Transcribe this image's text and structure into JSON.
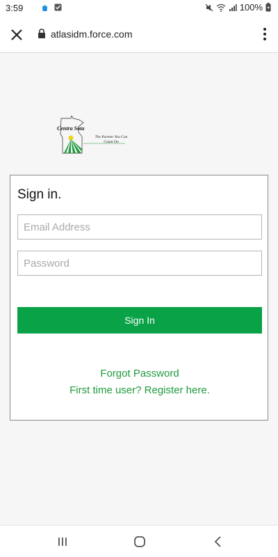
{
  "status_bar": {
    "time": "3:59",
    "battery": "100%"
  },
  "browser": {
    "url": "atlasidm.force.com"
  },
  "logo": {
    "name": "Centra Sota",
    "tagline": "The Partner You Can Count On",
    "colors": {
      "green": "#1f9a3c",
      "yellow": "#f2d21b"
    }
  },
  "signin": {
    "title": "Sign in.",
    "email_placeholder": "Email Address",
    "password_placeholder": "Password",
    "button_label": "Sign In",
    "forgot_link": "Forgot Password",
    "register_link": "First time user? Register here.",
    "accent_color": "#0aa246"
  },
  "icons": {
    "close": "close-icon",
    "lock": "lock-icon",
    "menu": "more-vert-icon",
    "wifi": "wifi-icon",
    "signal": "signal-icon",
    "mute": "mute-icon",
    "battery": "battery-icon"
  }
}
